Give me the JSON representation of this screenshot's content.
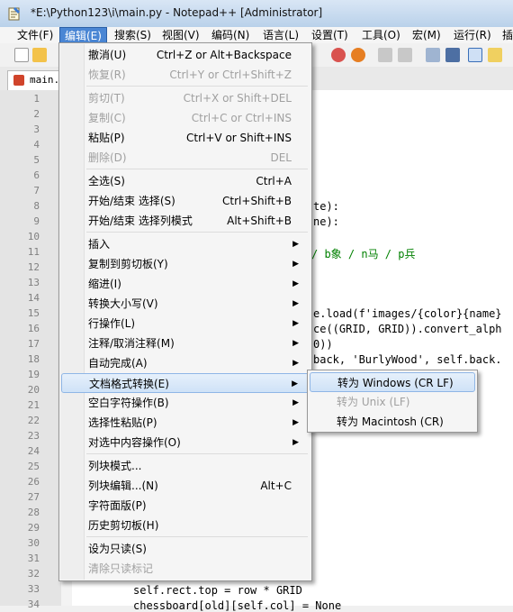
{
  "window": {
    "title": "*E:\\Python123\\i\\main.py - Notepad++ [Administrator]"
  },
  "menubar": [
    {
      "label": "文件(F)"
    },
    {
      "label": "编辑(E)"
    },
    {
      "label": "搜索(S)"
    },
    {
      "label": "视图(V)"
    },
    {
      "label": "编码(N)"
    },
    {
      "label": "语言(L)"
    },
    {
      "label": "设置(T)"
    },
    {
      "label": "工具(O)"
    },
    {
      "label": "宏(M)"
    },
    {
      "label": "运行(R)"
    },
    {
      "label": "插"
    }
  ],
  "tab": {
    "label": "main."
  },
  "line_numbers": [
    "1",
    "2",
    "3",
    "4",
    "5",
    "6",
    "7",
    "8",
    "9",
    "10",
    "11",
    "12",
    "13",
    "14",
    "15",
    "16",
    "17",
    "18",
    "19",
    "20",
    "21",
    "22",
    "23",
    "24",
    "25",
    "26",
    "27",
    "28",
    "29",
    "30",
    "31",
    "32",
    "33",
    "34"
  ],
  "code_fragments": {
    "l8": "te):",
    "l9": "ne):",
    "l11": "/ b象 / n马 / p兵",
    "l15a": "e.load(f'images/{color}{name}",
    "l16": "ce((GRID, GRID)).convert_alph",
    "l17": "0))",
    "l18": "back, 'BurlyWood', self.back.",
    "l33": "self.rect.top = row * GRID",
    "l34": "chessboard[old][self.col] = None"
  },
  "edit_menu": {
    "items": [
      {
        "label": "撤消(U)",
        "shortcut": "Ctrl+Z or Alt+Backspace",
        "disabled": false
      },
      {
        "label": "恢复(R)",
        "shortcut": "Ctrl+Y or Ctrl+Shift+Z",
        "disabled": true
      },
      {
        "label": "剪切(T)",
        "shortcut": "Ctrl+X or Shift+DEL",
        "disabled": true
      },
      {
        "label": "复制(C)",
        "shortcut": "Ctrl+C or Ctrl+INS",
        "disabled": true
      },
      {
        "label": "粘贴(P)",
        "shortcut": "Ctrl+V or Shift+INS",
        "disabled": false
      },
      {
        "label": "删除(D)",
        "shortcut": "DEL",
        "disabled": true
      },
      {
        "label": "全选(S)",
        "shortcut": "Ctrl+A",
        "disabled": false
      },
      {
        "label": "开始/结束 选择(S)",
        "shortcut": "Ctrl+Shift+B",
        "disabled": false
      },
      {
        "label": "开始/结束 选择列模式",
        "shortcut": "Alt+Shift+B",
        "disabled": false
      },
      {
        "label": "插入",
        "shortcut": "",
        "disabled": false,
        "submenu": true
      },
      {
        "label": "复制到剪切板(Y)",
        "shortcut": "",
        "disabled": false,
        "submenu": true
      },
      {
        "label": "缩进(I)",
        "shortcut": "",
        "disabled": false,
        "submenu": true
      },
      {
        "label": "转换大小写(V)",
        "shortcut": "",
        "disabled": false,
        "submenu": true
      },
      {
        "label": "行操作(L)",
        "shortcut": "",
        "disabled": false,
        "submenu": true
      },
      {
        "label": "注释/取消注释(M)",
        "shortcut": "",
        "disabled": false,
        "submenu": true
      },
      {
        "label": "自动完成(A)",
        "shortcut": "",
        "disabled": false,
        "submenu": true
      },
      {
        "label": "文档格式转换(E)",
        "shortcut": "",
        "disabled": false,
        "submenu": true,
        "highlighted": true
      },
      {
        "label": "空白字符操作(B)",
        "shortcut": "",
        "disabled": false,
        "submenu": true
      },
      {
        "label": "选择性粘贴(P)",
        "shortcut": "",
        "disabled": false,
        "submenu": true
      },
      {
        "label": "对选中内容操作(O)",
        "shortcut": "",
        "disabled": false,
        "submenu": true
      },
      {
        "label": "列块模式...",
        "shortcut": "",
        "disabled": false
      },
      {
        "label": "列块编辑...(N)",
        "shortcut": "Alt+C",
        "disabled": false
      },
      {
        "label": "字符面版(P)",
        "shortcut": "",
        "disabled": false
      },
      {
        "label": "历史剪切板(H)",
        "shortcut": "",
        "disabled": false
      },
      {
        "label": "设为只读(S)",
        "shortcut": "",
        "disabled": false
      },
      {
        "label": "清除只读标记",
        "shortcut": "",
        "disabled": true
      }
    ]
  },
  "eol_submenu": {
    "items": [
      {
        "label": "转为 Windows (CR LF)",
        "disabled": false,
        "highlighted": true
      },
      {
        "label": "转为 Unix (LF)",
        "disabled": true
      },
      {
        "label": "转为 Macintosh (CR)",
        "disabled": false
      }
    ]
  },
  "colors": {
    "menu_active": "#4a86d4",
    "highlight_border": "#8fb6e6",
    "comment_green": "#008000"
  }
}
